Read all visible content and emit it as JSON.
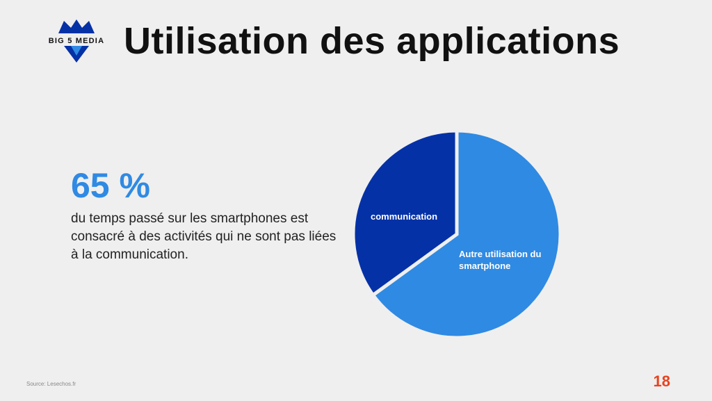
{
  "header": {
    "logo_text": "BIG 5 MEDIA",
    "title": "Utilisation des applications"
  },
  "stat": {
    "value": "65 %",
    "description": "du temps passé sur les smartphones est consacré à des activités qui ne sont pas liées à la communication."
  },
  "chart_data": {
    "type": "pie",
    "slices": [
      {
        "label": "Autre utilisation du smartphone",
        "label_lines": [
          "Autre utilisation du",
          "smartphone"
        ],
        "value": 65,
        "color": "#2f8ae3"
      },
      {
        "label": "communication",
        "label_lines": [
          "communication"
        ],
        "value": 35,
        "color": "#0431a6"
      }
    ]
  },
  "footer": {
    "source": "Source: Lesechos.fr",
    "page_number": "18"
  },
  "colors": {
    "accent": "#2f8ae3",
    "dark_blue": "#0431a6",
    "page_number": "#e8421e"
  }
}
